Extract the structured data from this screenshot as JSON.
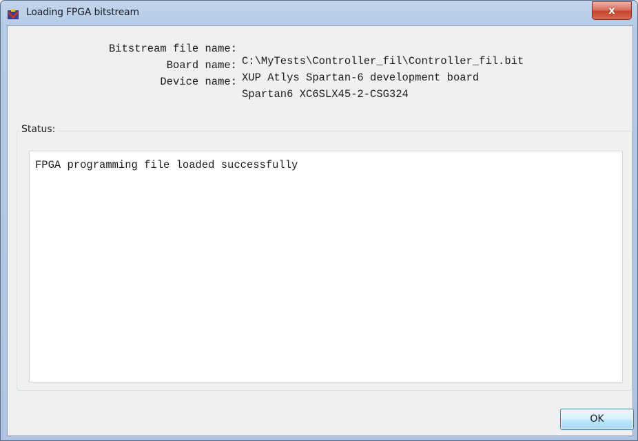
{
  "window": {
    "title": "Loading FPGA bitstream",
    "close_label": "x"
  },
  "info": [
    {
      "label": "Bitstream file name:",
      "value": "C:\\MyTests\\Controller_fil\\Controller_fil.bit"
    },
    {
      "label": "Board name:",
      "value": "XUP Atlys Spartan-6 development board"
    },
    {
      "label": "Device name:",
      "value": "Spartan6 XC6SLX45-2-CSG324"
    }
  ],
  "status": {
    "label": "Status:",
    "text": "FPGA programming file loaded successfully"
  },
  "buttons": {
    "ok_label": "OK"
  },
  "icons": {
    "title_icon": "matlab-fpga-icon"
  },
  "colors": {
    "close_button": "#c6452e",
    "ok_button_border": "#3c7fb1"
  }
}
